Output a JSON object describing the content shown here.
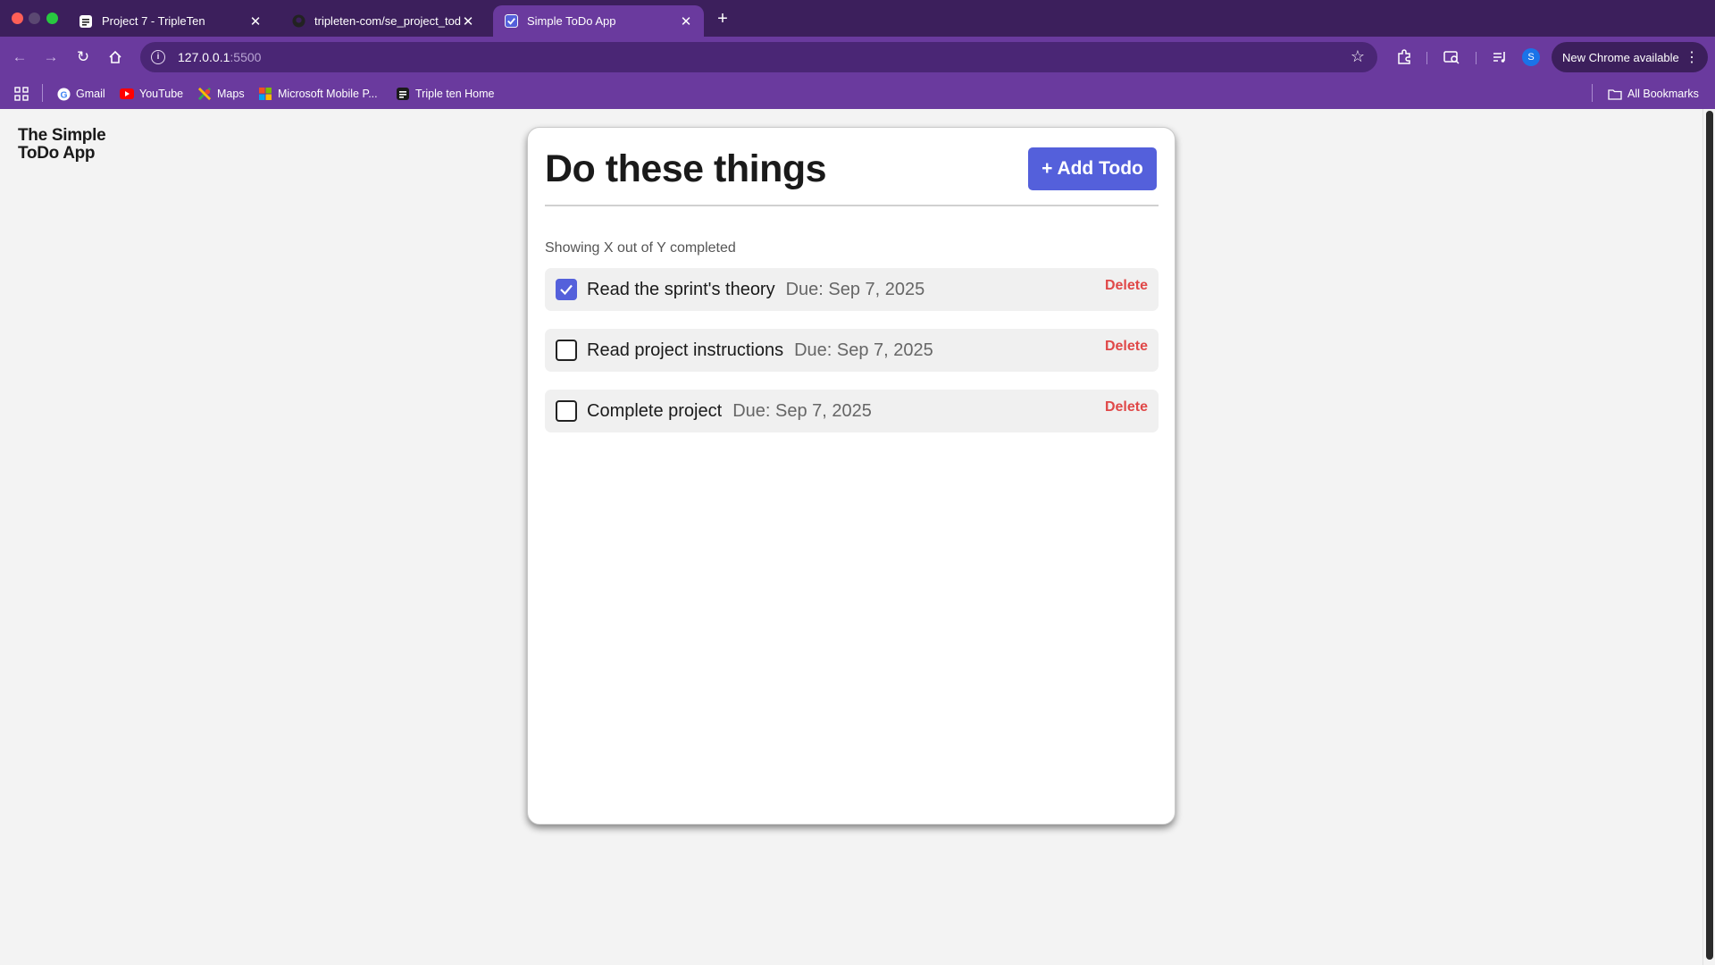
{
  "browser": {
    "tabs": [
      {
        "title": "Project 7 - TripleTen",
        "active": false
      },
      {
        "title": "tripleten-com/se_project_tod",
        "active": false
      },
      {
        "title": "Simple ToDo App",
        "active": true
      }
    ],
    "url_host": "127.0.0.1",
    "url_port": ":5500",
    "profile_initial": "S",
    "update_label": "New Chrome available",
    "bookmarks": [
      "Gmail",
      "YouTube",
      "Maps",
      "Microsoft Mobile P...",
      "Triple ten Home"
    ],
    "all_bookmarks_label": "All Bookmarks"
  },
  "app": {
    "logo_line1": "The Simple",
    "logo_line2": "ToDo App",
    "title": "Do these things",
    "add_button": "+ Add Todo",
    "counter": "Showing X out of Y completed",
    "todos": [
      {
        "name": "Read the sprint's theory",
        "due": "Due: Sep 7, 2025",
        "completed": true,
        "delete_label": "Delete"
      },
      {
        "name": "Read project instructions",
        "due": "Due: Sep 7, 2025",
        "completed": false,
        "delete_label": "Delete"
      },
      {
        "name": "Complete project",
        "due": "Due: Sep 7, 2025",
        "completed": false,
        "delete_label": "Delete"
      }
    ]
  },
  "colors": {
    "accent": "#5460db",
    "delete": "#e04848",
    "chrome_tabbar": "#3c1f5c",
    "chrome_toolbar": "#6a3a9e"
  }
}
